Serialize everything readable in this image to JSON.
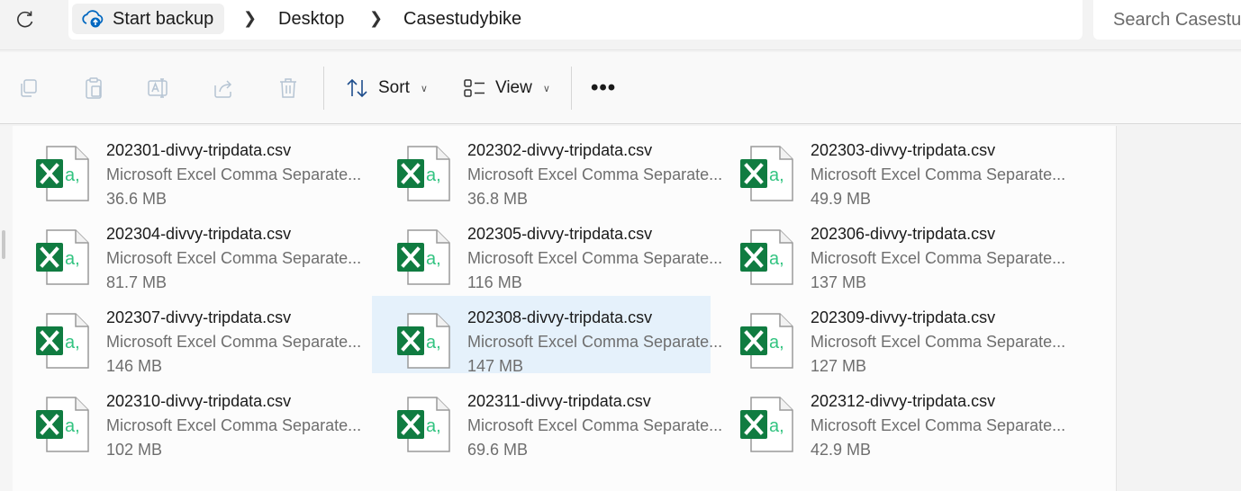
{
  "breadcrumb": {
    "root_label": "Start backup",
    "items": [
      "Desktop",
      "Casestudybike"
    ]
  },
  "search": {
    "placeholder": "Search Casestudybike"
  },
  "toolbar": {
    "sort_label": "Sort",
    "view_label": "View",
    "more_label": "•••"
  },
  "files": [
    {
      "name": "202301-divvy-tripdata.csv",
      "type": "Microsoft Excel Comma Separate...",
      "size": "36.6 MB",
      "selected": false
    },
    {
      "name": "202302-divvy-tripdata.csv",
      "type": "Microsoft Excel Comma Separate...",
      "size": "36.8 MB",
      "selected": false
    },
    {
      "name": "202303-divvy-tripdata.csv",
      "type": "Microsoft Excel Comma Separate...",
      "size": "49.9 MB",
      "selected": false
    },
    {
      "name": "202304-divvy-tripdata.csv",
      "type": "Microsoft Excel Comma Separate...",
      "size": "81.7 MB",
      "selected": false
    },
    {
      "name": "202305-divvy-tripdata.csv",
      "type": "Microsoft Excel Comma Separate...",
      "size": "116 MB",
      "selected": false
    },
    {
      "name": "202306-divvy-tripdata.csv",
      "type": "Microsoft Excel Comma Separate...",
      "size": "137 MB",
      "selected": false
    },
    {
      "name": "202307-divvy-tripdata.csv",
      "type": "Microsoft Excel Comma Separate...",
      "size": "146 MB",
      "selected": false
    },
    {
      "name": "202308-divvy-tripdata.csv",
      "type": "Microsoft Excel Comma Separate...",
      "size": "147 MB",
      "selected": true
    },
    {
      "name": "202309-divvy-tripdata.csv",
      "type": "Microsoft Excel Comma Separate...",
      "size": "127 MB",
      "selected": false
    },
    {
      "name": "202310-divvy-tripdata.csv",
      "type": "Microsoft Excel Comma Separate...",
      "size": "102 MB",
      "selected": false
    },
    {
      "name": "202311-divvy-tripdata.csv",
      "type": "Microsoft Excel Comma Separate...",
      "size": "69.6 MB",
      "selected": false
    },
    {
      "name": "202312-divvy-tripdata.csv",
      "type": "Microsoft Excel Comma Separate...",
      "size": "42.9 MB",
      "selected": false
    }
  ],
  "colors": {
    "excel_green": "#107c41",
    "excel_light_green": "#33c481",
    "selection": "#e5f1fb",
    "accent_blue": "#0067c0"
  }
}
